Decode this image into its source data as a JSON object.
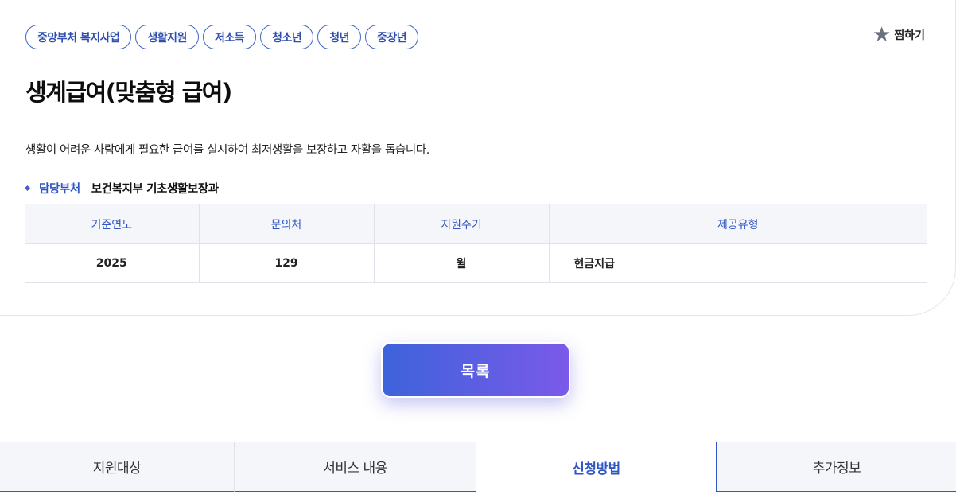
{
  "tags": [
    "중앙부처 복지사업",
    "생활지원",
    "저소득",
    "청소년",
    "청년",
    "중장년"
  ],
  "bookmark": {
    "icon": "star-icon",
    "label": "찜하기"
  },
  "title": "생계급여(맞춤형 급여)",
  "description": "생활이 어려운 사람에게 필요한 급여를 실시하여 최저생활을 보장하고 자활을 돕습니다.",
  "department": {
    "key": "담당부처",
    "value": "보건복지부 기초생활보장과"
  },
  "info_table": {
    "headers": [
      "기준연도",
      "문의처",
      "지원주기",
      "제공유형"
    ],
    "row": [
      "2025",
      "129",
      "월",
      "현금지급"
    ]
  },
  "list_button": "목록",
  "tabs": [
    {
      "label": "지원대상",
      "active": false
    },
    {
      "label": "서비스 내용",
      "active": false
    },
    {
      "label": "신청방법",
      "active": true
    },
    {
      "label": "추가정보",
      "active": false
    }
  ],
  "colors": {
    "accent": "#3157c4",
    "gradient_start": "#3d63db",
    "gradient_end": "#7a5ae9"
  }
}
